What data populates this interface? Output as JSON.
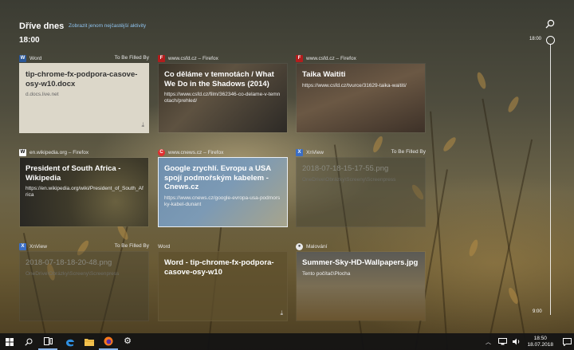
{
  "header": {
    "title": "Dříve dnes",
    "link": "Zobrazit jenom nejčastější aktivity",
    "time": "18:00"
  },
  "timeline": {
    "top_label": "18:00",
    "bottom_label": "9:00"
  },
  "rows": [
    [
      {
        "app": "Word",
        "filed": "To Be Filled By",
        "title": "tip-chrome-fx-podpora-casove-osy-w10.docx",
        "sub": "d.docs.live.net",
        "download": true
      },
      {
        "app": "www.csfd.cz – Firefox",
        "filed": "",
        "title": "Co děláme v temnotách / What We Do in the Shadows (2014)",
        "sub": "https://www.csfd.cz/film/362346-co-delame-v-temnotach/prehled/",
        "download": false
      },
      {
        "app": "www.csfd.cz – Firefox",
        "filed": "",
        "title": "Taika Waititi",
        "sub": "https://www.csfd.cz/tvurce/31629-taika-waititi/",
        "download": false
      }
    ],
    [
      {
        "app": "en.wikipedia.org – Firefox",
        "filed": "",
        "title": "President of South Africa - Wikipedia",
        "sub": "https://en.wikipedia.org/wiki/President_of_South_Africa",
        "download": false
      },
      {
        "app": "www.cnews.cz – Firefox",
        "filed": "",
        "title": "Google zrychlí. Evropu a USA spojí podmořským kabelem - Cnews.cz",
        "sub": "https://www.cnews.cz/google-evropa-usa-podmorsky-kabel-dunant",
        "download": false
      },
      {
        "app": "XnView",
        "filed": "To Be Filled By",
        "title": "2018-07-18-15-17-55.png",
        "sub": "OneDrive\\Obrázky\\Screeny\\Screenpress",
        "download": false
      }
    ],
    [
      {
        "app": "XnView",
        "filed": "To Be Filled By",
        "title": "2018-07-18-18-20-48.png",
        "sub": "OneDrive\\Obrázky\\Screeny\\Screenpress",
        "download": false
      },
      {
        "app": "Word",
        "filed": "",
        "title": "Word - tip-chrome-fx-podpora-casove-osy-w10",
        "sub": "",
        "download": true
      },
      {
        "app": "Malování",
        "filed": "",
        "title": "Summer-Sky-HD-Wallpapers.jpg",
        "sub": "Tento počítač\\Plocha",
        "download": false
      }
    ]
  ],
  "taskbar": {
    "time": "18:50",
    "date": "18.07.2018"
  },
  "colors": {
    "accent": "#8fc3ee",
    "selection_border": "#e9eef3"
  }
}
